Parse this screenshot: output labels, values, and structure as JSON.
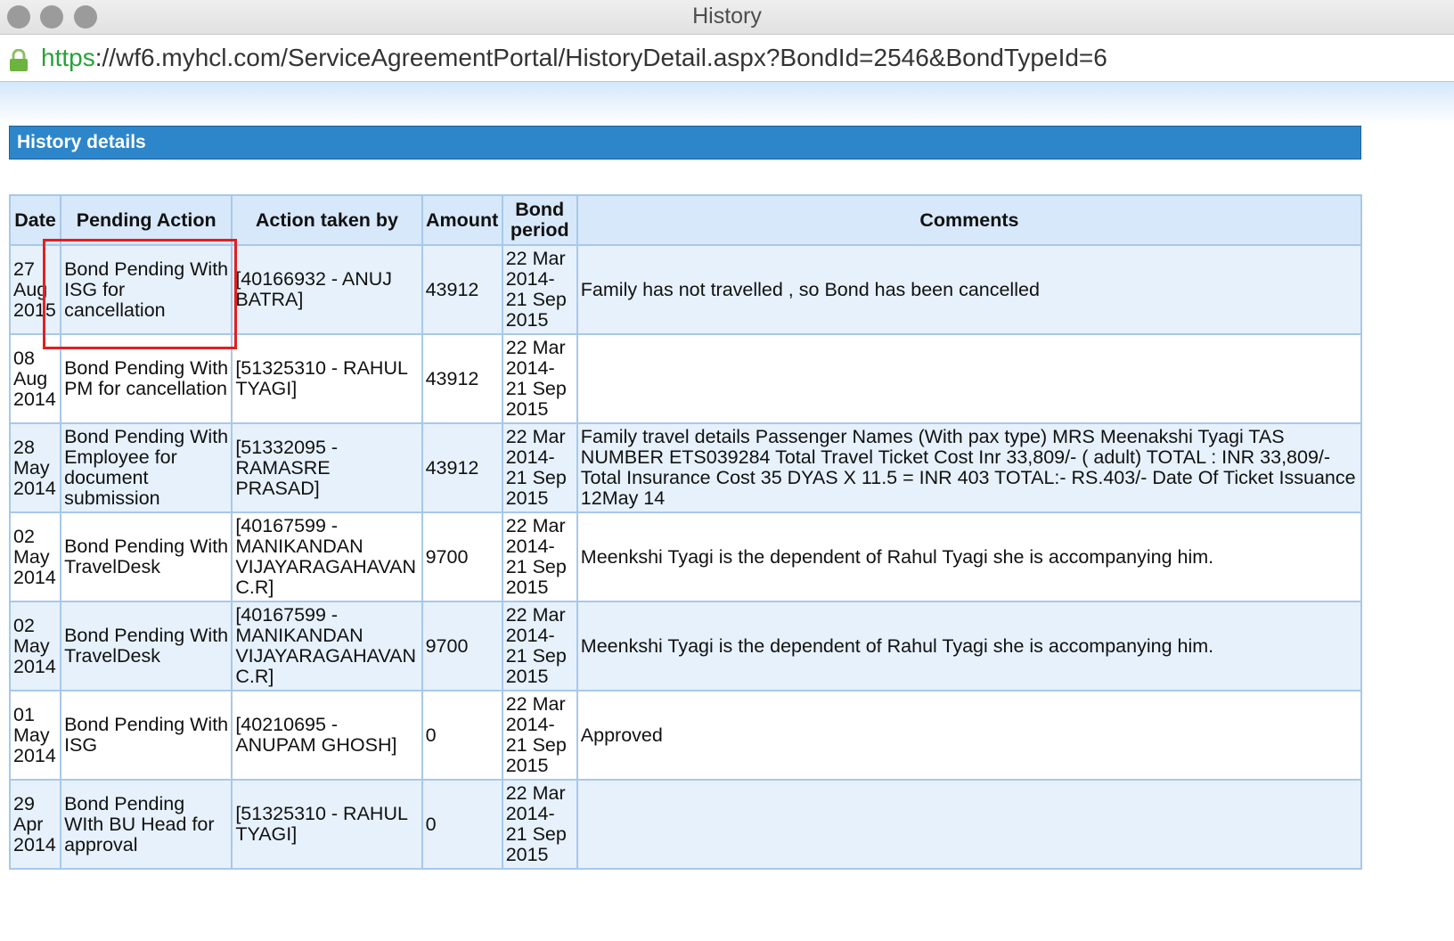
{
  "window": {
    "title": "History"
  },
  "address_bar": {
    "scheme": "https",
    "rest": "://wf6.myhcl.com/ServiceAgreementPortal/HistoryDetail.aspx?BondId=2546&BondTypeId=6"
  },
  "section": {
    "title": "History details"
  },
  "table": {
    "headers": [
      "Date",
      "Pending Action",
      "Action taken by",
      "Amount",
      "Bond period",
      "Comments"
    ],
    "rows": [
      {
        "date": "27 Aug 2015",
        "pending_action": "Bond Pending With ISG for cancellation",
        "action_taken_by": "[40166932 - ANUJ BATRA]",
        "amount": "43912",
        "bond_period": "22 Mar 2014- 21 Sep 2015",
        "comments": "Family has not travelled , so Bond has been cancelled"
      },
      {
        "date": "08 Aug 2014",
        "pending_action": "Bond Pending With PM for cancellation",
        "action_taken_by": "[51325310 - RAHUL TYAGI]",
        "amount": "43912",
        "bond_period": "22 Mar 2014- 21 Sep 2015",
        "comments": ""
      },
      {
        "date": "28 May 2014",
        "pending_action": "Bond Pending With Employee for document submission",
        "action_taken_by": "[51332095 - RAMASRE PRASAD]",
        "amount": "43912",
        "bond_period": "22 Mar 2014- 21 Sep 2015",
        "comments": "Family travel details Passenger Names (With pax type) MRS Meenakshi Tyagi TAS NUMBER ETS039284 Total Travel Ticket Cost Inr 33,809/- ( adult) TOTAL : INR 33,809/- Total Insurance Cost 35 DYAS X 11.5 = INR 403 TOTAL:- RS.403/- Date Of Ticket Issuance 12May 14"
      },
      {
        "date": "02 May 2014",
        "pending_action": "Bond Pending With TravelDesk",
        "action_taken_by": "[40167599 - MANIKANDAN VIJAYARAGAHAVAN C.R]",
        "amount": "9700",
        "bond_period": "22 Mar 2014- 21 Sep 2015",
        "comments": "Meenkshi Tyagi is the dependent of Rahul Tyagi she is accompanying him."
      },
      {
        "date": "02 May 2014",
        "pending_action": "Bond Pending With TravelDesk",
        "action_taken_by": "[40167599 - MANIKANDAN VIJAYARAGAHAVAN C.R]",
        "amount": "9700",
        "bond_period": "22 Mar 2014- 21 Sep 2015",
        "comments": "Meenkshi Tyagi is the dependent of Rahul Tyagi she is accompanying him."
      },
      {
        "date": "01 May 2014",
        "pending_action": "Bond Pending With ISG",
        "action_taken_by": "[40210695 - ANUPAM GHOSH]",
        "amount": "0",
        "bond_period": "22 Mar 2014- 21 Sep 2015",
        "comments": "Approved"
      },
      {
        "date": "29 Apr 2014",
        "pending_action": "Bond Pending WIth BU Head for approval",
        "action_taken_by": "[51325310 - RAHUL TYAGI]",
        "amount": "0",
        "bond_period": "22 Mar 2014- 21 Sep 2015",
        "comments": ""
      }
    ]
  },
  "colors": {
    "header_bar": "#2d86ca",
    "table_border": "#a8c8ea",
    "table_header_bg": "#d7e8fa",
    "row_alt_bg": "#e6f1fc",
    "highlight_box": "#e02020",
    "url_scheme": "#26a239"
  }
}
